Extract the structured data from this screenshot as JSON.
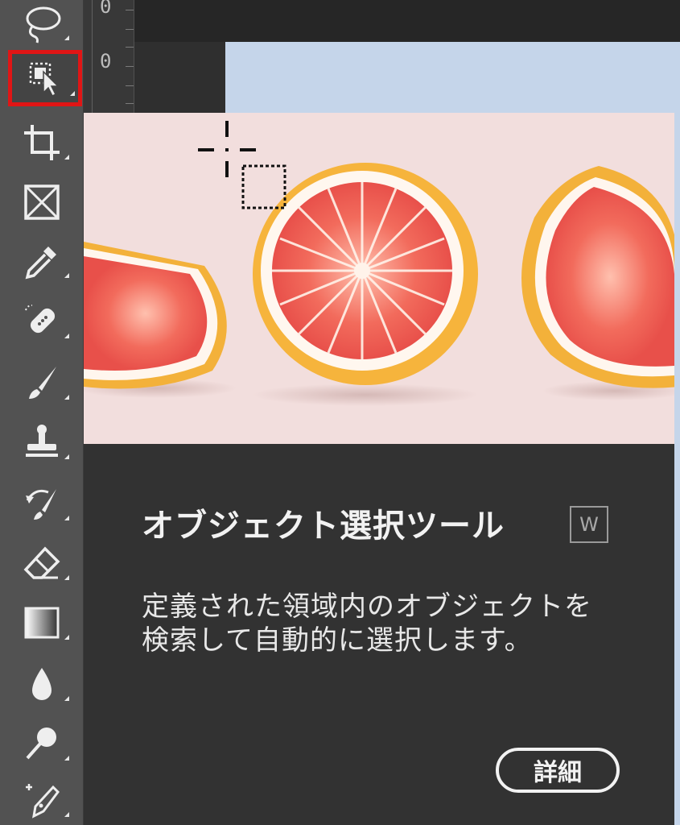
{
  "toolbar": {
    "tools": [
      {
        "name": "lasso-tool",
        "icon": "lasso-icon"
      },
      {
        "name": "object-selection-tool",
        "icon": "object-selection-icon",
        "selected": true
      },
      {
        "name": "crop-tool",
        "icon": "crop-icon"
      },
      {
        "name": "frame-tool",
        "icon": "frame-icon"
      },
      {
        "name": "eyedropper-tool",
        "icon": "eyedropper-icon"
      },
      {
        "name": "spot-healing-tool",
        "icon": "bandage-icon"
      },
      {
        "name": "brush-tool",
        "icon": "brush-icon"
      },
      {
        "name": "clone-stamp-tool",
        "icon": "stamp-icon"
      },
      {
        "name": "history-brush-tool",
        "icon": "history-brush-icon"
      },
      {
        "name": "eraser-tool",
        "icon": "eraser-icon"
      },
      {
        "name": "gradient-tool",
        "icon": "gradient-icon"
      },
      {
        "name": "blur-tool",
        "icon": "drop-icon"
      },
      {
        "name": "dodge-tool",
        "icon": "dodge-icon"
      },
      {
        "name": "pen-tool",
        "icon": "pen-icon"
      }
    ]
  },
  "ruler": {
    "labels": [
      "0",
      "0"
    ]
  },
  "tooltip": {
    "title": "オブジェクト選択ツール",
    "shortcut": "W",
    "description": "定義された領域内のオブジェクトを検索して自動的に選択します。",
    "detail_button": "詳細",
    "highlight_color": "#e01515"
  }
}
